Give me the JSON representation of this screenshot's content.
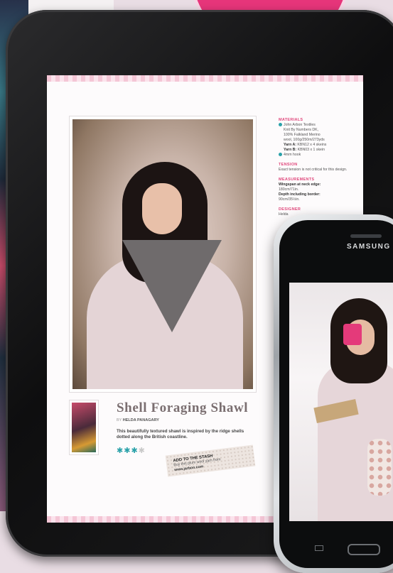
{
  "background": {
    "color": "#e9dde4",
    "accent": "#e6357a"
  },
  "tablet": {
    "sidebar": {
      "materials_heading": "MATERIALS",
      "materials_lines": [
        "John Arbon Textiles",
        "Knit By Numbers DK,",
        "100% Falkland Merino",
        "wool, 100g/250m/273yds"
      ],
      "yarn_a_label": "Yarn A:",
      "yarn_a_value": "KBN12 x 4 skeins",
      "yarn_b_label": "Yarn B:",
      "yarn_b_value": "KBN03 x 1 skein",
      "hook": "4mm hook",
      "tension_heading": "TENSION",
      "tension_text": "Exact tension is not critical for this design.",
      "measurements_heading": "MEASUREMENTS",
      "wingspan_label": "Wingspan at neck edge:",
      "wingspan_value": "180cm/71in.",
      "depth_label": "Depth including border:",
      "depth_value": "90cm/35½in.",
      "designer_heading": "DESIGNER",
      "designer_text": "Helda"
    },
    "title": "Shell Foraging Shawl",
    "byline_prefix": "BY",
    "author": "HELDA PANAGARY",
    "description": "This beautifully textured shawl is inspired by the ridge shells dotted along the British coastline.",
    "rating": {
      "filled": 3,
      "total": 4,
      "symbol": "✱"
    },
    "stash": {
      "heading": "ADD TO THE STASH",
      "line1": "Buy this plum wool yarn from",
      "line2": "www.jarbon.com"
    }
  },
  "phone": {
    "brand": "SAMSUNG"
  },
  "colors": {
    "heading_pink": "#e0487c",
    "teal": "#2aa1a9"
  }
}
